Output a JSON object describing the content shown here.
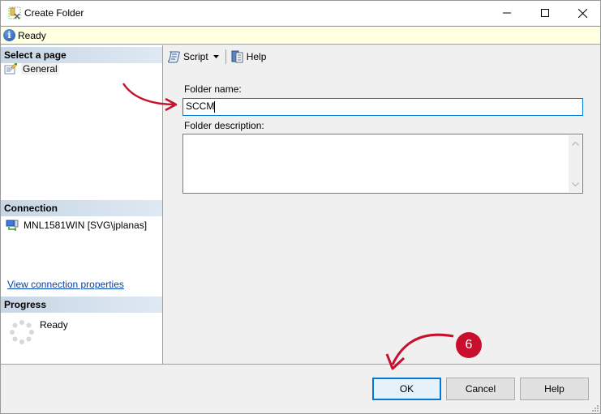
{
  "window": {
    "title": "Create Folder",
    "controls": {
      "minimize": "minimize",
      "maximize": "maximize",
      "close": "close"
    }
  },
  "status": {
    "text": "Ready",
    "icon": "info-icon"
  },
  "left_pane": {
    "select_page_header": "Select a page",
    "pages": [
      {
        "label": "General",
        "icon": "general-page-icon"
      }
    ],
    "connection_header": "Connection",
    "connection": {
      "label": "MNL1581WIN [SVG\\jplanas]",
      "icon": "server-connection-icon"
    },
    "view_connection_link": "View connection properties",
    "progress_header": "Progress",
    "progress_status": "Ready"
  },
  "toolbar": {
    "script_label": "Script",
    "help_label": "Help"
  },
  "form": {
    "folder_name_label": "Folder name:",
    "folder_name_value": "SCCM",
    "folder_description_label": "Folder description:",
    "folder_description_value": ""
  },
  "buttons": {
    "ok": "OK",
    "cancel": "Cancel",
    "help": "Help"
  },
  "annotation": {
    "step_number": "6",
    "color": "#c8102e"
  }
}
